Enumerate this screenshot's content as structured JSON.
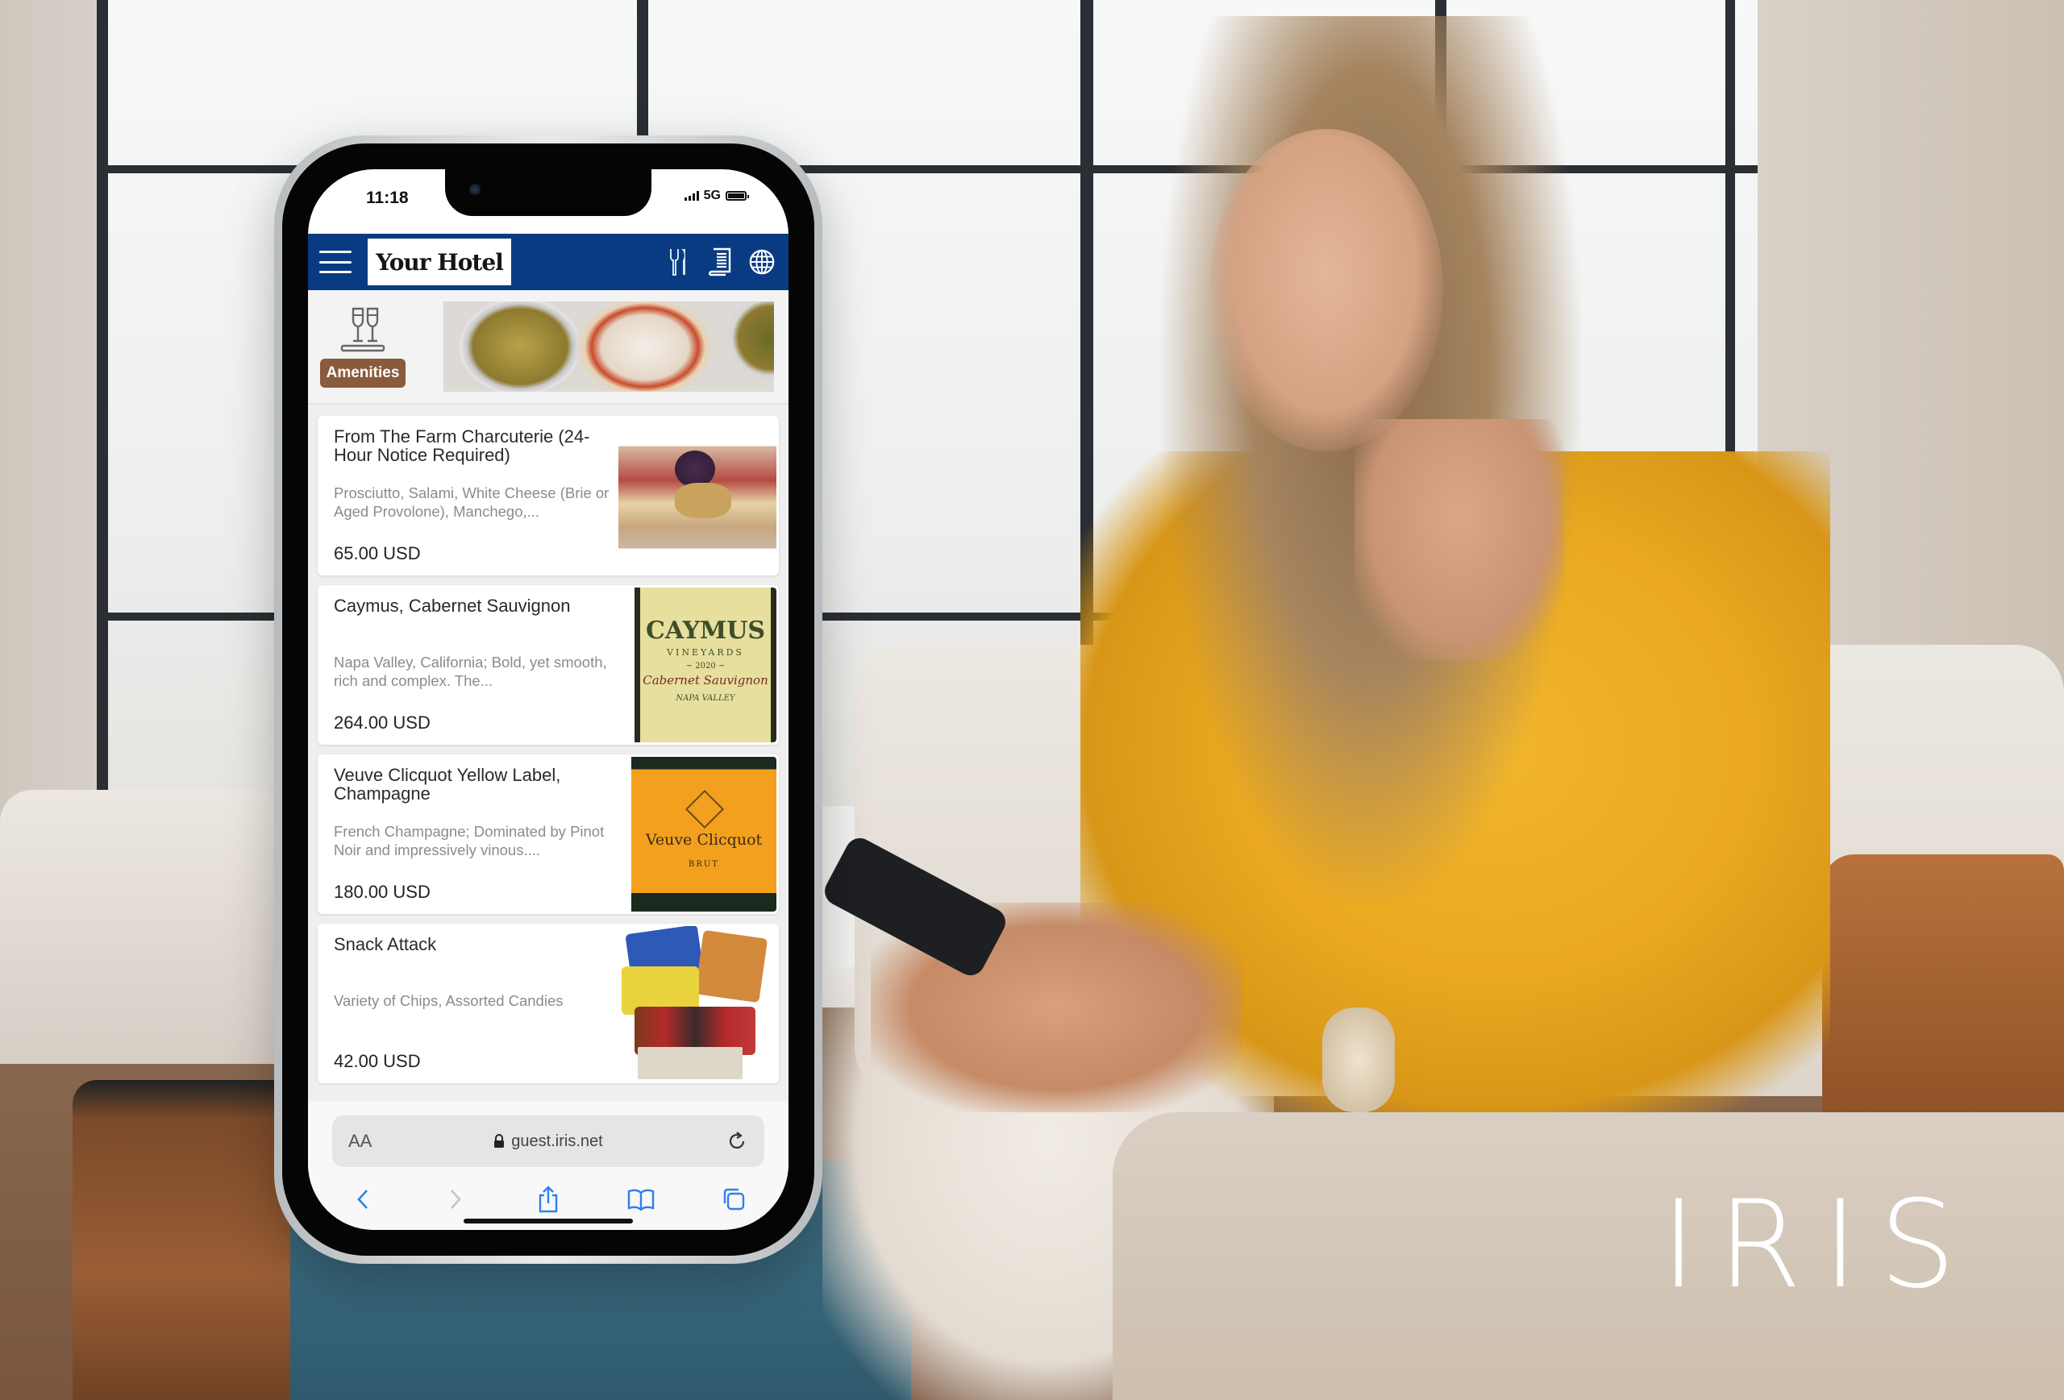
{
  "brand": {
    "logo_text": "IRIS"
  },
  "phone": {
    "status_bar": {
      "time": "11:18",
      "network": "5G"
    },
    "navbar": {
      "hotel_name": "Your Hotel",
      "accent_color": "#083b82",
      "icons": [
        "menu-icon",
        "dining-icon",
        "receipt-icon",
        "globe-icon"
      ]
    },
    "category": {
      "label": "Amenities",
      "icon": "champagne-glasses-icon",
      "label_color": "#8a5a3c"
    },
    "menu_items": [
      {
        "name": "From The Farm Charcuterie (24-Hour Notice Required)",
        "description": "Prosciutto, Salami, White Cheese (Brie or Aged Provolone), Manchego,...",
        "price": "65.00 USD"
      },
      {
        "name": "Caymus, Cabernet Sauvignon",
        "description": "Napa Valley, California; Bold, yet smooth, rich and complex. The...",
        "price": "264.00 USD",
        "label_text": [
          "CAYMUS",
          "VINEYARDS",
          "~ 2020 ~",
          "Cabernet Sauvignon",
          "NAPA VALLEY"
        ]
      },
      {
        "name": "Veuve Clicquot Yellow Label, Champagne",
        "description": "French Champagne; Dominated by Pinot Noir and impressively vinous....",
        "price": "180.00 USD",
        "label_text": [
          "Veuve Clicquot",
          "BRUT"
        ]
      },
      {
        "name": "Snack Attack",
        "description": "Variety of Chips, Assorted Candies",
        "price": "42.00 USD"
      }
    ],
    "browser": {
      "text_size_label": "AA",
      "url": "guest.iris.net",
      "toolbar": [
        "back-icon",
        "forward-icon",
        "share-icon",
        "bookmarks-icon",
        "tabs-icon"
      ]
    }
  }
}
